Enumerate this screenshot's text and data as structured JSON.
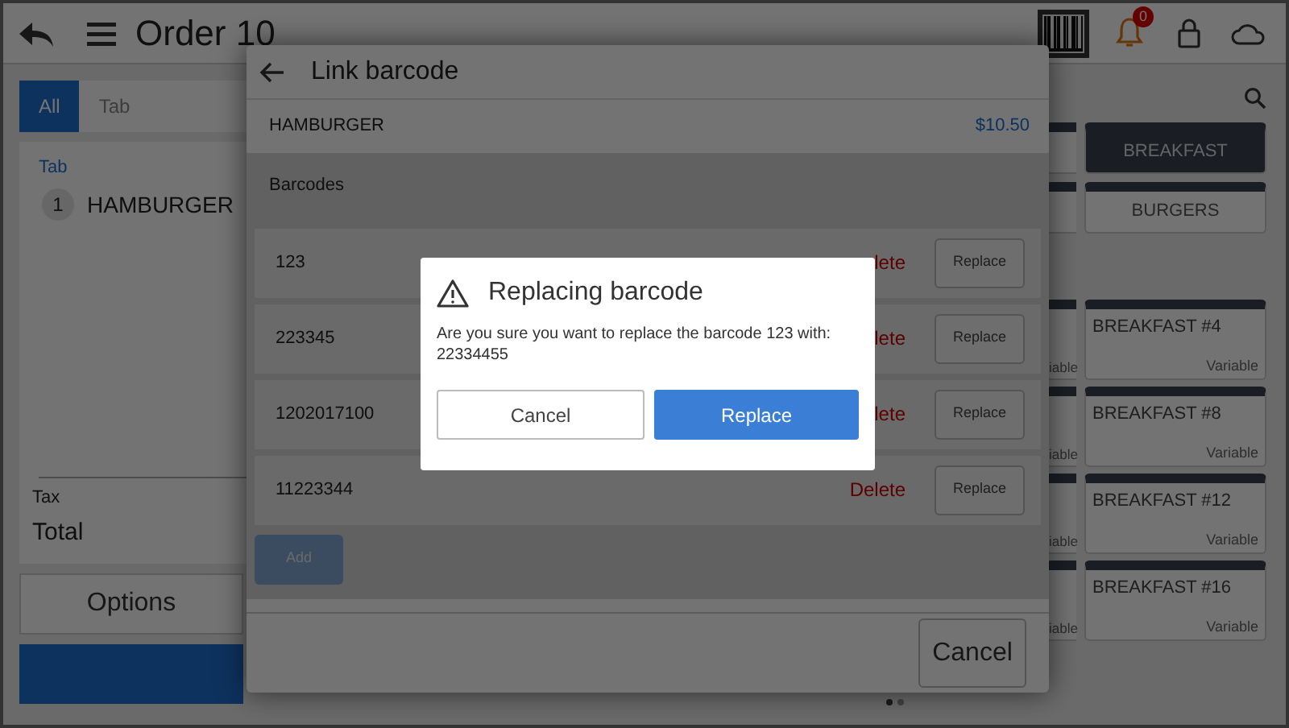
{
  "header": {
    "title": "Order 10",
    "notification_count": "0"
  },
  "order_tabs": [
    {
      "label": "All",
      "selected": true
    },
    {
      "label": "Tab",
      "selected": false
    }
  ],
  "order": {
    "group": "Tab",
    "items": [
      {
        "quantity": "1",
        "name": "HAMBURGER"
      }
    ],
    "tax_label": "Tax",
    "total_label": "Total"
  },
  "options_button": "Options",
  "categories": [
    {
      "label": "BREAKFAST",
      "selected": true
    },
    {
      "label": "BURGERS",
      "selected": false
    }
  ],
  "products": [
    {
      "covered_tag": "iable",
      "name": "BREAKFAST #4",
      "tag": "Variable"
    },
    {
      "covered_tag": "iable",
      "name": "BREAKFAST #8",
      "tag": "Variable"
    },
    {
      "covered_tag": "iable",
      "name": "BREAKFAST #12",
      "tag": "Variable"
    },
    {
      "covered_tag": "iable",
      "name": "BREAKFAST #16",
      "tag": "Variable"
    }
  ],
  "link_barcode": {
    "title": "Link barcode",
    "product": "HAMBURGER",
    "price": "$10.50",
    "section": "Barcodes",
    "barcodes": [
      {
        "code": "123",
        "delete": "lete",
        "replace": "Replace"
      },
      {
        "code": "223345",
        "delete": "lete",
        "replace": "Replace"
      },
      {
        "code": "1202017100",
        "delete": "lete",
        "replace": "Replace"
      },
      {
        "code": "11223344",
        "delete": "Delete",
        "replace": "Replace"
      }
    ],
    "add_button": {
      "label": "Add",
      "disabled": true
    },
    "cancel_button": "Cancel"
  },
  "dialog": {
    "title": "Replacing barcode",
    "message": "Are you sure you want to replace the barcode 123 with: 22334455",
    "cancel": "Cancel",
    "confirm": "Replace"
  }
}
